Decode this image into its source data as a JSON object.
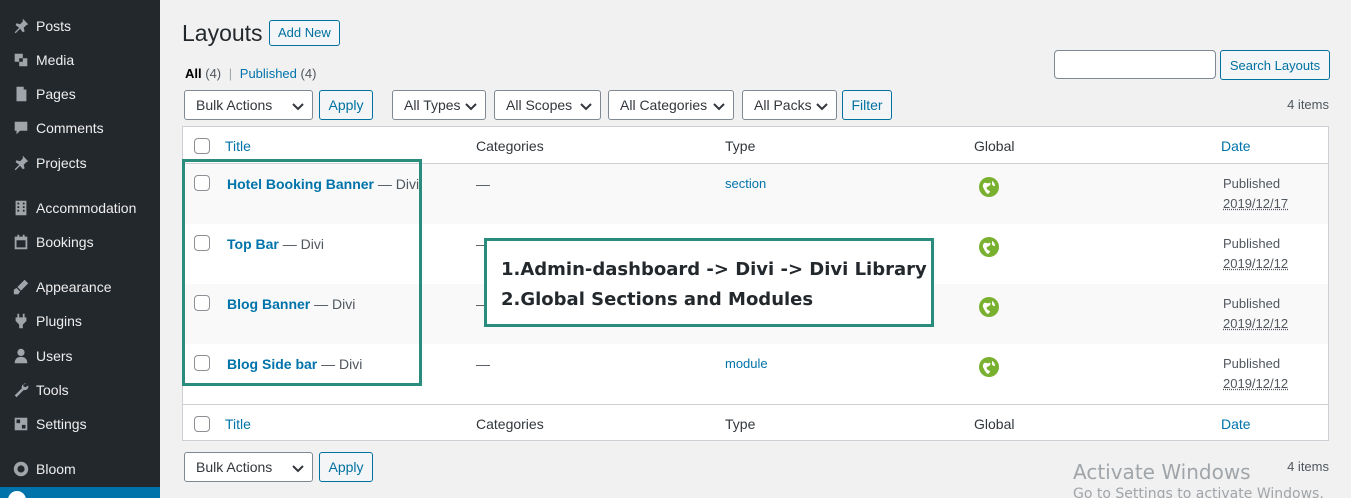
{
  "sidebar": {
    "items": [
      {
        "label": "Posts",
        "icon": "pin-icon"
      },
      {
        "label": "Media",
        "icon": "media-icon"
      },
      {
        "label": "Pages",
        "icon": "pages-icon"
      },
      {
        "label": "Comments",
        "icon": "comment-icon"
      },
      {
        "label": "Projects",
        "icon": "pin-icon"
      },
      {
        "label": "Accommodation",
        "icon": "building-icon"
      },
      {
        "label": "Bookings",
        "icon": "calendar-icon"
      },
      {
        "label": "Appearance",
        "icon": "brush-icon"
      },
      {
        "label": "Plugins",
        "icon": "plugin-icon"
      },
      {
        "label": "Users",
        "icon": "user-icon"
      },
      {
        "label": "Tools",
        "icon": "wrench-icon"
      },
      {
        "label": "Settings",
        "icon": "settings-icon"
      },
      {
        "label": "Bloom",
        "icon": "bloom-icon"
      }
    ]
  },
  "header": {
    "title": "Layouts",
    "add_new": "Add New"
  },
  "filters_views": {
    "all_label": "All",
    "all_count": "(4)",
    "separator": "|",
    "published_label": "Published",
    "published_count": "(4)"
  },
  "search": {
    "value": "",
    "button": "Search Layouts"
  },
  "tablenav_top": {
    "bulk_actions": "Bulk Actions",
    "apply": "Apply",
    "types": "All Types",
    "scopes": "All Scopes",
    "categories": "All Categories",
    "packs": "All Packs",
    "filter": "Filter",
    "items_count": "4 items"
  },
  "table": {
    "columns": {
      "title": "Title",
      "categories": "Categories",
      "type": "Type",
      "global": "Global",
      "date": "Date"
    },
    "rows": [
      {
        "title": "Hotel Booking Banner",
        "suffix": " — Divi",
        "categories": "—",
        "type": "section",
        "status": "Published",
        "date": "2019/12/17"
      },
      {
        "title": "Top Bar",
        "suffix": " — Divi",
        "categories": "—",
        "type": "",
        "status": "Published",
        "date": "2019/12/12"
      },
      {
        "title": "Blog Banner",
        "suffix": " — Divi",
        "categories": "—",
        "type": "",
        "status": "Published",
        "date": "2019/12/12"
      },
      {
        "title": "Blog Side bar",
        "suffix": " — Divi",
        "categories": "—",
        "type": "module",
        "status": "Published",
        "date": "2019/12/12"
      }
    ]
  },
  "tablenav_bottom": {
    "bulk_actions": "Bulk Actions",
    "apply": "Apply",
    "items_count": "4 items"
  },
  "annotation": {
    "line1": "1.Admin-dashboard -> Divi -> Divi Library",
    "line2": "2.Global Sections and Modules"
  },
  "watermark": {
    "line1": "Activate Windows",
    "line2": "Go to Settings to activate Windows."
  },
  "colors": {
    "sidebar_bg": "#23282d",
    "link": "#0073aa",
    "annotation_border": "#2a8c7c",
    "global_icon": "#7ab030"
  }
}
